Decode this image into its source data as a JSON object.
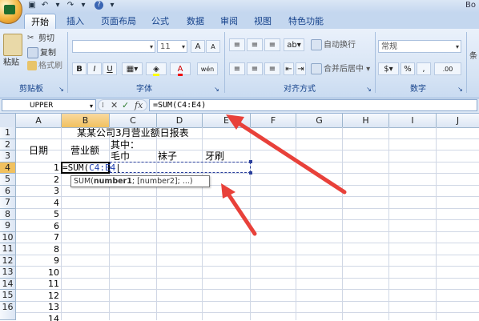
{
  "app": {
    "title_fragment": "Bo",
    "tabs": [
      "开始",
      "插入",
      "页面布局",
      "公式",
      "数据",
      "审阅",
      "视图",
      "特色功能"
    ]
  },
  "ribbon": {
    "clipboard": {
      "paste": "粘贴",
      "cut": "剪切",
      "copy": "复制",
      "format_painter": "格式刷",
      "label": "剪贴板"
    },
    "font": {
      "font_name": "",
      "font_size": "11",
      "bold": "B",
      "italic": "I",
      "underline": "U",
      "grow": "A",
      "shrink": "A",
      "font_color": "A",
      "phonetic": "wén",
      "label": "字体"
    },
    "alignment": {
      "wrap_text": "自动换行",
      "merge_center": "合并后居中",
      "label": "对齐方式"
    },
    "number": {
      "format": "常规",
      "currency": "$",
      "percent": "%",
      "comma": ",",
      "inc_decimal": ".00",
      "label": "数字"
    },
    "styles_partial": "条"
  },
  "formula_bar": {
    "name_box": "UPPER",
    "cancel": "✕",
    "enter": "✓",
    "fx": "fx",
    "formula": "=SUM(C4:E4)"
  },
  "columns": [
    "A",
    "B",
    "C",
    "D",
    "E",
    "F",
    "G",
    "H",
    "I",
    "J"
  ],
  "rows": [
    "1",
    "2",
    "3",
    "4",
    "5",
    "6",
    "7",
    "8",
    "9",
    "10",
    "11",
    "12",
    "13",
    "14",
    "15",
    "16"
  ],
  "sheet": {
    "title": "某某公司3月营业额日报表",
    "header_date": "日期",
    "header_revenue": "营业额",
    "header_of_which": "其中：",
    "header_towel": "毛巾",
    "header_socks": "袜子",
    "header_toothbrush": "牙刷",
    "dates": [
      "1",
      "2",
      "3",
      "4",
      "5",
      "6",
      "7",
      "8",
      "9",
      "10",
      "11",
      "12",
      "13",
      "14"
    ],
    "b4_prefix": "=SUM(",
    "b4_ref": "C4:E4",
    "b4_cursor": "|"
  },
  "tooltip": {
    "fn": "SUM(",
    "arg1": "number1",
    "rest": "; [number2]; ...)"
  },
  "colors": {
    "arrow": "#e8413a",
    "selected_header": "#f1c15f",
    "ribbon_text": "#15428b",
    "range_border": "#2a3f9c"
  }
}
